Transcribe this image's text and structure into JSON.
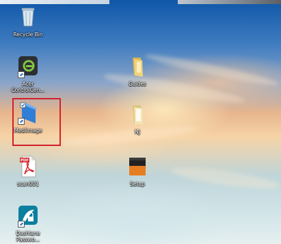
{
  "desktop": {
    "icons": [
      {
        "label": "Recycle Bin",
        "icon": "recycle-bin-icon"
      },
      {
        "label": "Acer\nControlCen...",
        "icon": "acer-control-center-icon"
      },
      {
        "label": "Guides",
        "icon": "folder-icon"
      },
      {
        "label": "Mediimage",
        "icon": "app-icon"
      },
      {
        "label": "NJ",
        "icon": "folder-icon"
      },
      {
        "label": "scan001",
        "icon": "pdf-icon"
      },
      {
        "label": "Setup",
        "icon": "setup-box-icon"
      },
      {
        "label": "Dashlane\nPasswo...",
        "icon": "dashlane-icon"
      }
    ],
    "selected_label": "Mediimage",
    "colors": {
      "selection": "#d21f2a"
    }
  }
}
